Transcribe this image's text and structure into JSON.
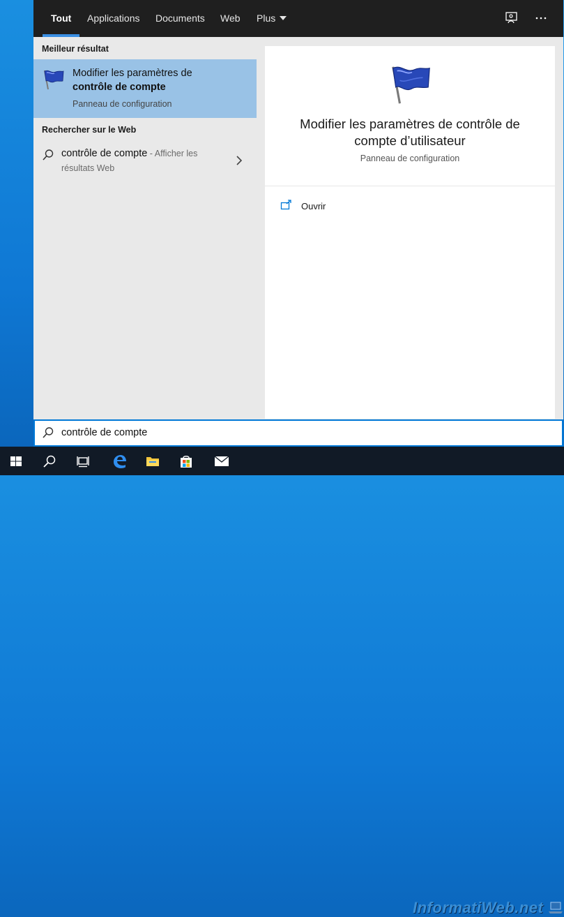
{
  "tabs": [
    {
      "label": "Tout",
      "active": true
    },
    {
      "label": "Applications",
      "active": false
    },
    {
      "label": "Documents",
      "active": false
    },
    {
      "label": "Web",
      "active": false
    },
    {
      "label": "Plus",
      "active": false
    }
  ],
  "top_actions": {
    "feedback_icon": "feedback-icon",
    "more_icon": "more-icon"
  },
  "best_match": {
    "header": "Meilleur résultat",
    "title_line1": "Modifier les paramètres de",
    "title_line2": "contrôle de compte",
    "subtitle": "Panneau de configuration",
    "icon": "uac-flag-icon"
  },
  "web_search": {
    "header": "Rechercher sur le Web",
    "query": "contrôle de compte",
    "suffix": " - Afficher les",
    "subline": "résultats Web"
  },
  "detail": {
    "title": "Modifier les paramètres de contrôle de compte d’utilisateur",
    "subtitle": "Panneau de configuration",
    "action_label": "Ouvrir"
  },
  "search": {
    "value": "contrôle de compte",
    "placeholder": ""
  },
  "taskbar": {
    "items": [
      "start-icon",
      "search-icon",
      "task-view-icon",
      "edge-icon",
      "file-explorer-icon",
      "store-icon",
      "mail-icon"
    ]
  },
  "watermark": "InformatiWeb.net",
  "colors": {
    "accent": "#0078d7",
    "selected": "#99c2e6",
    "topbar": "#1f1f1f",
    "taskbar": "#111a26"
  }
}
